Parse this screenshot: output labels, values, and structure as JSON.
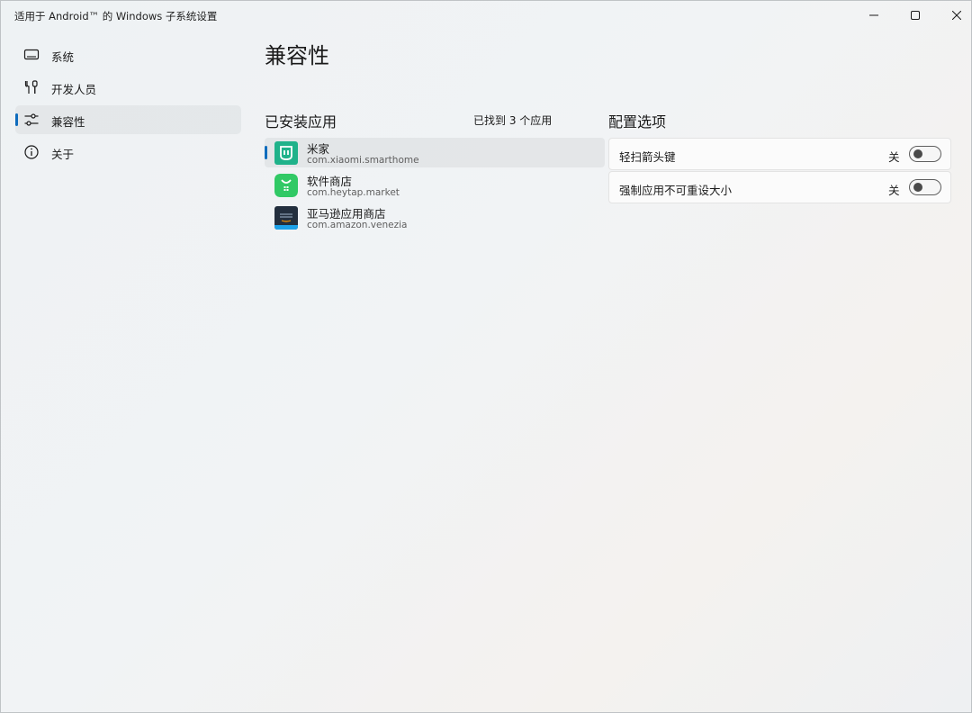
{
  "window": {
    "title": "适用于 Android™ 的 Windows 子系统设置"
  },
  "sidebar": {
    "items": [
      {
        "label": "系统",
        "icon": "laptop-icon"
      },
      {
        "label": "开发人员",
        "icon": "tools-icon"
      },
      {
        "label": "兼容性",
        "icon": "sliders-icon",
        "selected": true
      },
      {
        "label": "关于",
        "icon": "info-icon"
      }
    ]
  },
  "main": {
    "page_title": "兼容性",
    "installed_title": "已安装应用",
    "found_count": "已找到 3 个应用",
    "apps": [
      {
        "name": "米家",
        "package": "com.xiaomi.smarthome",
        "selected": true
      },
      {
        "name": "软件商店",
        "package": "com.heytap.market"
      },
      {
        "name": "亚马逊应用商店",
        "package": "com.amazon.venezia"
      }
    ],
    "options_title": "配置选项",
    "options": [
      {
        "label": "轻扫箭头键",
        "state": "关"
      },
      {
        "label": "强制应用不可重设大小",
        "state": "关"
      }
    ]
  },
  "colors": {
    "accent": "#0f6cbd",
    "mijia_icon": "#1fb28a",
    "store_icon": "#31c965",
    "amazon_icon": "#232f3e"
  }
}
